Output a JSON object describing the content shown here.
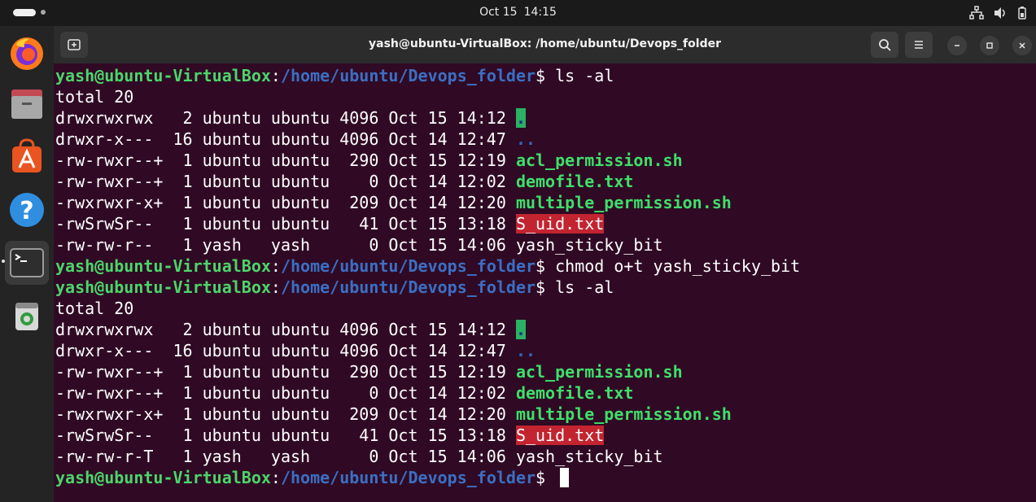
{
  "topbar": {
    "date": "Oct 15",
    "time": "14:15"
  },
  "dock": {
    "items": [
      "firefox-icon",
      "files-icon",
      "app-center-icon",
      "help-icon",
      "terminal-icon",
      "trash-icon"
    ]
  },
  "window": {
    "title": "yash@ubuntu-VirtualBox: /home/ubuntu/Devops_folder"
  },
  "terminal": {
    "user_host": "yash@ubuntu-VirtualBox",
    "path": "/home/ubuntu/Devops_folder",
    "lines": [
      {
        "type": "prompt",
        "cmd": "ls -al"
      },
      {
        "type": "text",
        "text": "total 20"
      },
      {
        "type": "entry",
        "meta": "drwxrwxrwx   2 ubuntu ubuntu 4096 Oct 15 14:12",
        "name": ".",
        "style": "dirw"
      },
      {
        "type": "entry",
        "meta": "drwxr-x---  16 ubuntu ubuntu 4096 Oct 14 12:47",
        "name": "..",
        "style": "dir"
      },
      {
        "type": "entry",
        "meta": "-rw-rwxr--+  1 ubuntu ubuntu  290 Oct 15 12:19",
        "name": "acl_permission.sh",
        "style": "exe"
      },
      {
        "type": "entry",
        "meta": "-rw-rwxr--+  1 ubuntu ubuntu    0 Oct 14 12:02",
        "name": "demofile.txt",
        "style": "exe"
      },
      {
        "type": "entry",
        "meta": "-rwxrwxr-x+  1 ubuntu ubuntu  209 Oct 14 12:20",
        "name": "multiple_permission.sh",
        "style": "exe"
      },
      {
        "type": "entry",
        "meta": "-rwSrwSr--   1 ubuntu ubuntu   41 Oct 15 13:18",
        "name": "S_uid.txt",
        "style": "suid"
      },
      {
        "type": "entry",
        "meta": "-rw-rw-r--   1 yash   yash      0 Oct 15 14:06",
        "name": "yash_sticky_bit",
        "style": "plain"
      },
      {
        "type": "prompt",
        "cmd": "chmod o+t yash_sticky_bit"
      },
      {
        "type": "prompt",
        "cmd": "ls -al"
      },
      {
        "type": "text",
        "text": "total 20"
      },
      {
        "type": "entry",
        "meta": "drwxrwxrwx   2 ubuntu ubuntu 4096 Oct 15 14:12",
        "name": ".",
        "style": "dirw"
      },
      {
        "type": "entry",
        "meta": "drwxr-x---  16 ubuntu ubuntu 4096 Oct 14 12:47",
        "name": "..",
        "style": "dir"
      },
      {
        "type": "entry",
        "meta": "-rw-rwxr--+  1 ubuntu ubuntu  290 Oct 15 12:19",
        "name": "acl_permission.sh",
        "style": "exe"
      },
      {
        "type": "entry",
        "meta": "-rw-rwxr--+  1 ubuntu ubuntu    0 Oct 14 12:02",
        "name": "demofile.txt",
        "style": "exe"
      },
      {
        "type": "entry",
        "meta": "-rwxrwxr-x+  1 ubuntu ubuntu  209 Oct 14 12:20",
        "name": "multiple_permission.sh",
        "style": "exe"
      },
      {
        "type": "entry",
        "meta": "-rwSrwSr--   1 ubuntu ubuntu   41 Oct 15 13:18",
        "name": "S_uid.txt",
        "style": "suid"
      },
      {
        "type": "entry",
        "meta": "-rw-rw-r-T   1 yash   yash      0 Oct 15 14:06",
        "name": "yash_sticky_bit",
        "style": "plain"
      },
      {
        "type": "prompt",
        "cmd": "",
        "cursor": true
      }
    ]
  },
  "colors": {
    "terminal_bg": "#300a24",
    "prompt_user": "#4bd66a",
    "prompt_path": "#3b6fc4",
    "executable": "#3ee06a",
    "directory": "#2f67c2",
    "suid_bg": "#c22430",
    "world_writable_bg": "#2ab163"
  }
}
